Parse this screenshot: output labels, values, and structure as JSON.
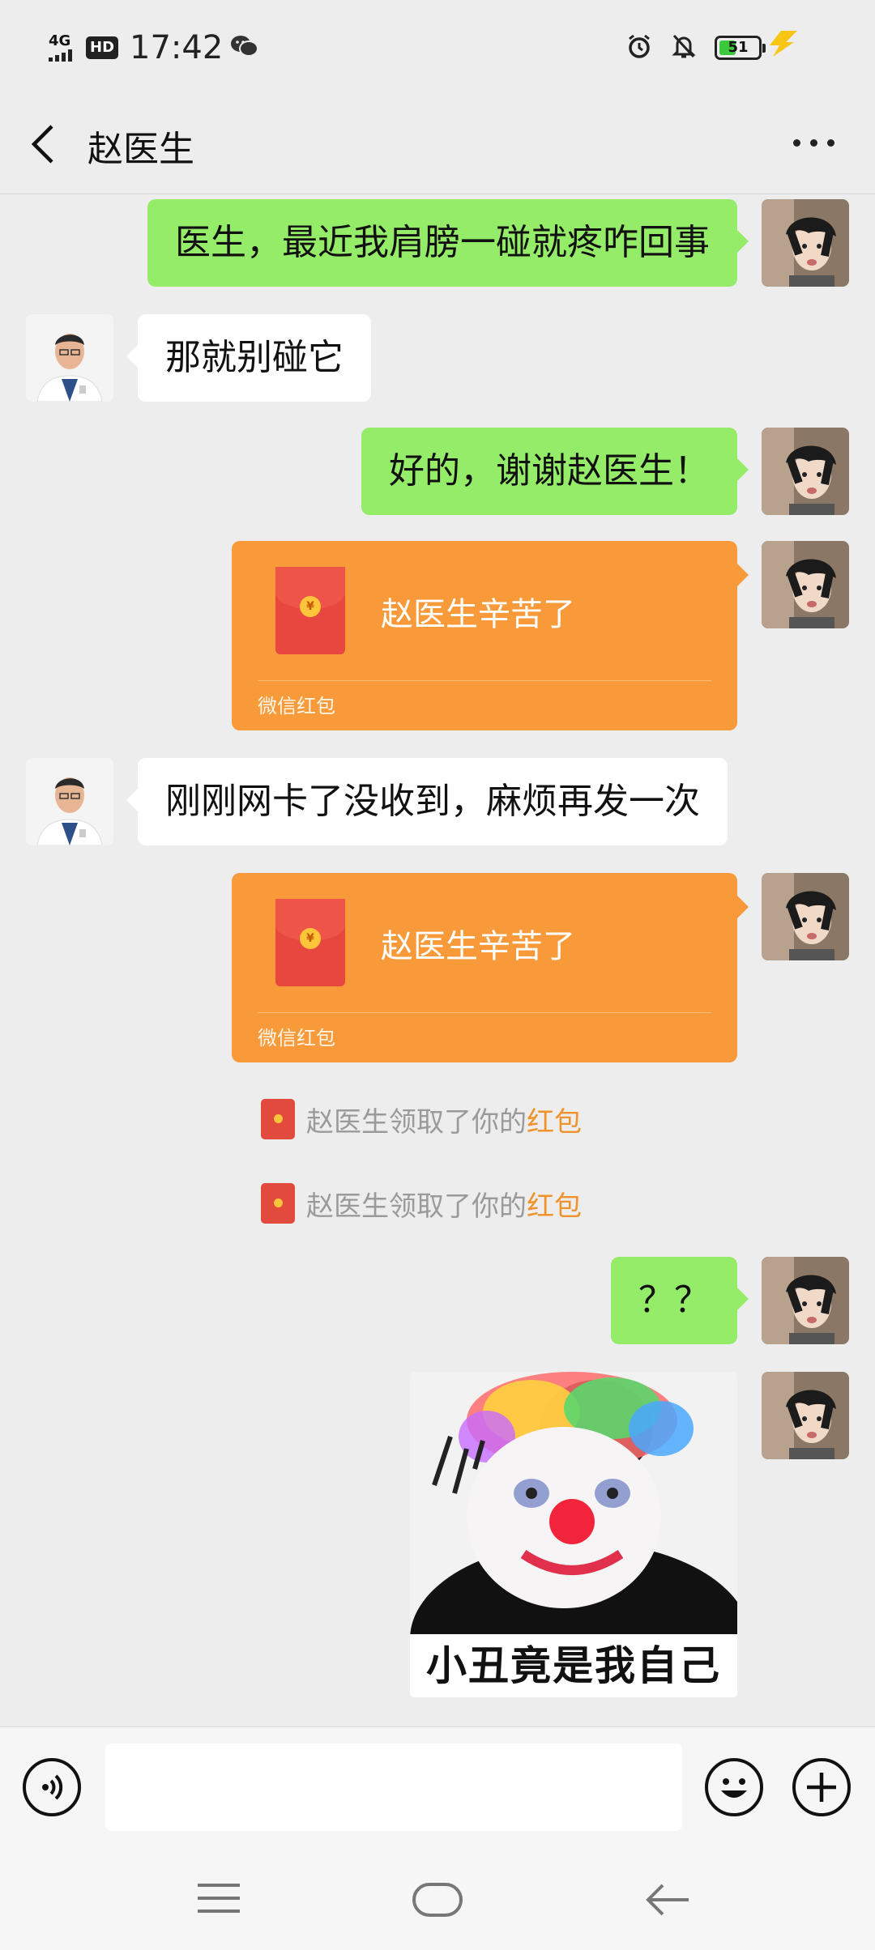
{
  "status_bar": {
    "network": "4G",
    "hd": "HD",
    "time": "17:42",
    "battery": "51"
  },
  "header": {
    "title": "赵医生"
  },
  "messages": [
    {
      "from": "me",
      "text": "医生，最近我肩膀一碰就疼咋回事"
    },
    {
      "from": "doctor",
      "text": "那就别碰它"
    },
    {
      "from": "me",
      "text": "好的，谢谢赵医生！"
    },
    {
      "from": "me",
      "type": "red_packet",
      "title": "赵医生辛苦了",
      "footer": "微信红包"
    },
    {
      "from": "doctor",
      "text": "刚刚网卡了没收到，麻烦再发一次"
    },
    {
      "from": "me",
      "type": "red_packet",
      "title": "赵医生辛苦了",
      "footer": "微信红包"
    },
    {
      "type": "system",
      "text": "赵医生领取了你的",
      "highlight": "红包"
    },
    {
      "type": "system",
      "text": "赵医生领取了你的",
      "highlight": "红包"
    },
    {
      "from": "me",
      "text": "？？"
    },
    {
      "from": "me",
      "type": "sticker",
      "caption": "小丑竟是我自己"
    }
  ],
  "colors": {
    "me_bubble": "#95ec69",
    "red_packet": "#f89a3a",
    "highlight": "#f0922a"
  }
}
